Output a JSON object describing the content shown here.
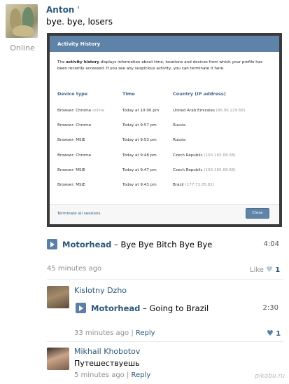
{
  "post": {
    "author": "Anton",
    "author_mark": "'",
    "text": "bye. bye, losers",
    "status": "Online"
  },
  "modal": {
    "title": "Activity History",
    "desc_bold": "activity history",
    "desc_pre": "The ",
    "desc_post": " displays information about time, locations and devices from which your profile has been recently accessed. If you see any suspicious activity, you can terminate it here.",
    "columns": [
      "Device type",
      "Time",
      "Country (IP address)"
    ],
    "rows": [
      {
        "device": "Browser: Chrome",
        "status": "online",
        "time": "Today at 10:00 pm",
        "country": "United Arab Emirates",
        "ip": "(86.96.229.68)"
      },
      {
        "device": "Browser: Chrome",
        "status": "",
        "time": "Today at 9:57 pm",
        "country": "Russia",
        "ip": ""
      },
      {
        "device": "Browser: MSIE",
        "status": "",
        "time": "Today at 9:53 pm",
        "country": "Russia",
        "ip": ""
      },
      {
        "device": "Browser: Chrome",
        "status": "",
        "time": "Today at 9:48 pm",
        "country": "Czech Republic",
        "ip": "(193.165.68.68)"
      },
      {
        "device": "Browser: MSIE",
        "status": "",
        "time": "Today at 9:47 pm",
        "country": "Czech Republic",
        "ip": "(193.165.68.68)"
      },
      {
        "device": "Browser: MSIE",
        "status": "",
        "time": "Today at 9:43 pm",
        "country": "Brazil",
        "ip": "(177.73.85.82)"
      }
    ],
    "terminate": "Terminate all sessions",
    "close": "Close"
  },
  "audio1": {
    "artist": "Motorhead",
    "sep": " – ",
    "title": "Bye Bye Bitch Bye Bye",
    "duration": "4:04"
  },
  "post_meta": {
    "time": "45 minutes ago",
    "like_label": "Like",
    "like_count": "1"
  },
  "comment1": {
    "name": "Kislotny Dzho",
    "audio": {
      "artist": "Motorhead",
      "sep": " – ",
      "title": "Going to Brazil",
      "duration": "2:30"
    },
    "time": "33 minutes ago",
    "sep": "|",
    "reply": "Reply",
    "likes": "1"
  },
  "comment2": {
    "name": "Mikhail Khobotov",
    "text": "Путешествуешь",
    "time": "5 minutes ago",
    "sep": "|",
    "reply": "Reply"
  },
  "watermark": "pikabu.ru",
  "colors": {
    "link": "#2b587a",
    "accent": "#5b7fa6",
    "muted": "#8f8f8f"
  }
}
